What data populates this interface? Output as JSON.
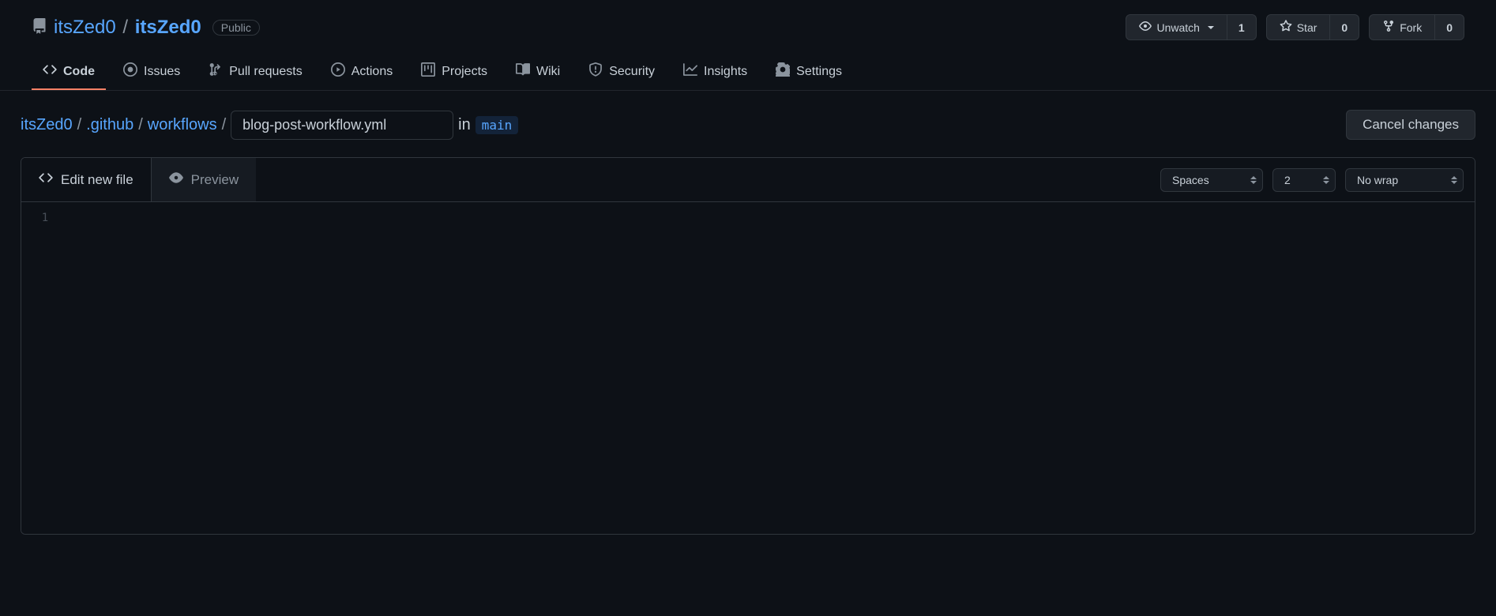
{
  "repo": {
    "owner": "itsZed0",
    "name": "itsZed0",
    "visibility": "Public"
  },
  "actions": {
    "unwatch": "Unwatch",
    "unwatch_count": "1",
    "star": "Star",
    "star_count": "0",
    "fork": "Fork",
    "fork_count": "0"
  },
  "nav": {
    "code": "Code",
    "issues": "Issues",
    "pulls": "Pull requests",
    "actions": "Actions",
    "projects": "Projects",
    "wiki": "Wiki",
    "security": "Security",
    "insights": "Insights",
    "settings": "Settings"
  },
  "breadcrumb": {
    "root": "itsZed0",
    "p1": ".github",
    "p2": "workflows",
    "filename": "blog-post-workflow.yml",
    "in": "in",
    "branch": "main"
  },
  "buttons": {
    "cancel": "Cancel changes"
  },
  "editor": {
    "edit_tab": "Edit new file",
    "preview_tab": "Preview",
    "indent_mode": "Spaces",
    "indent_size": "2",
    "wrap_mode": "No wrap",
    "line_number": "1"
  }
}
